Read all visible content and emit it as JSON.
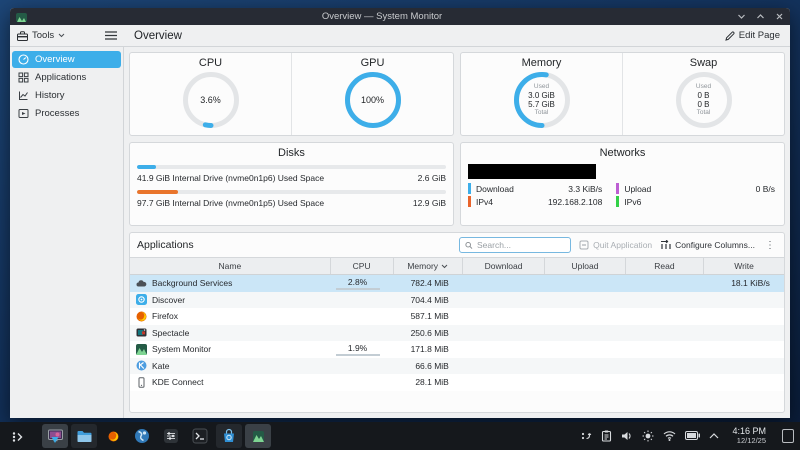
{
  "window": {
    "title": "Overview — System Monitor"
  },
  "toolbar": {
    "tools_label": "Tools"
  },
  "header": {
    "title": "Overview",
    "edit_page_label": "Edit Page"
  },
  "sidebar": {
    "items": [
      {
        "label": "Overview",
        "icon": "overview-icon",
        "active": true
      },
      {
        "label": "Applications",
        "icon": "applications-icon",
        "active": false
      },
      {
        "label": "History",
        "icon": "history-icon",
        "active": false
      },
      {
        "label": "Processes",
        "icon": "processes-icon",
        "active": false
      }
    ]
  },
  "gauges": {
    "cpu": {
      "title": "CPU",
      "percent": 3.6,
      "label": "3.6%"
    },
    "gpu": {
      "title": "GPU",
      "percent": 100,
      "label": "100%"
    },
    "memory": {
      "title": "Memory",
      "percent": 52.6,
      "used_label": "Used",
      "used": "3.0 GiB",
      "total": "5.7 GiB",
      "total_label": "Total"
    },
    "swap": {
      "title": "Swap",
      "percent": 0,
      "used_label": "Used",
      "used": "0 B",
      "total": "0 B",
      "total_label": "Total"
    }
  },
  "accent_color": "#3daee9",
  "disks": {
    "title": "Disks",
    "items": [
      {
        "label": "41.9 GiB Internal Drive (nvme0n1p6) Used Space",
        "value": "2.6 GiB",
        "percent": 6.2,
        "color": "#3daee9"
      },
      {
        "label": "97.7 GiB Internal Drive (nvme0n1p5) Used Space",
        "value": "12.9 GiB",
        "percent": 13.2,
        "color": "#e9752c"
      }
    ]
  },
  "networks": {
    "title": "Networks",
    "legend": [
      {
        "label": "Download",
        "value": "3.3 KiB/s",
        "color": "#3daee9",
        "col": "left"
      },
      {
        "label": "Upload",
        "value": "0 B/s",
        "color": "#bd5fd3",
        "col": "right"
      },
      {
        "label": "IPv4",
        "value": "192.168.2.108",
        "color": "#e9642c",
        "col": "left"
      },
      {
        "label": "IPv6",
        "value": "",
        "color": "#33d147",
        "col": "right"
      }
    ]
  },
  "applications": {
    "title": "Applications",
    "search_placeholder": "Search...",
    "quit_label": "Quit Application",
    "configure_label": "Configure Columns...",
    "columns": [
      "Name",
      "CPU",
      "Memory",
      "Download",
      "Upload",
      "Read",
      "Write"
    ],
    "sorted_column": "Memory",
    "rows": [
      {
        "name": "Background Services",
        "icon": "background-services-icon",
        "cpu": "2.8%",
        "memory": "782.4 MiB",
        "download": "",
        "upload": "",
        "read": "",
        "write": "18.1 KiB/s",
        "selected": true
      },
      {
        "name": "Discover",
        "icon": "discover-icon",
        "cpu": "",
        "memory": "704.4 MiB",
        "download": "",
        "upload": "",
        "read": "",
        "write": "",
        "selected": false
      },
      {
        "name": "Firefox",
        "icon": "firefox-icon",
        "cpu": "",
        "memory": "587.1 MiB",
        "download": "",
        "upload": "",
        "read": "",
        "write": "",
        "selected": false
      },
      {
        "name": "Spectacle",
        "icon": "spectacle-icon",
        "cpu": "",
        "memory": "250.6 MiB",
        "download": "",
        "upload": "",
        "read": "",
        "write": "",
        "selected": false
      },
      {
        "name": "System Monitor",
        "icon": "system-monitor-icon",
        "cpu": "1.9%",
        "memory": "171.8 MiB",
        "download": "",
        "upload": "",
        "read": "",
        "write": "",
        "selected": false
      },
      {
        "name": "Kate",
        "icon": "kate-icon",
        "cpu": "",
        "memory": "66.6 MiB",
        "download": "",
        "upload": "",
        "read": "",
        "write": "",
        "selected": false
      },
      {
        "name": "KDE Connect",
        "icon": "kde-connect-icon",
        "cpu": "",
        "memory": "28.1 MiB",
        "download": "",
        "upload": "",
        "read": "",
        "write": "",
        "selected": false
      }
    ]
  },
  "taskbar": {
    "apps": [
      {
        "icon": "display-app-icon",
        "state": "active",
        "badge": true
      },
      {
        "icon": "dolphin-icon",
        "state": "open",
        "badge": false
      },
      {
        "icon": "firefox-icon",
        "state": "none",
        "badge": false
      },
      {
        "icon": "kate-globe-icon",
        "state": "none",
        "badge": false
      },
      {
        "icon": "settings-icon",
        "state": "none",
        "badge": false
      },
      {
        "icon": "console-icon",
        "state": "none",
        "badge": false
      },
      {
        "icon": "discover-bag-icon",
        "state": "open",
        "badge": false
      },
      {
        "icon": "system-monitor-icon",
        "state": "active",
        "badge": false
      }
    ],
    "tray": [
      "input-device-icon",
      "clipboard-icon",
      "volume-icon",
      "brightness-icon",
      "wifi-icon",
      "battery-icon",
      "caret-up-icon"
    ],
    "clock": {
      "time": "4:16 PM",
      "date": "12/12/25"
    }
  }
}
